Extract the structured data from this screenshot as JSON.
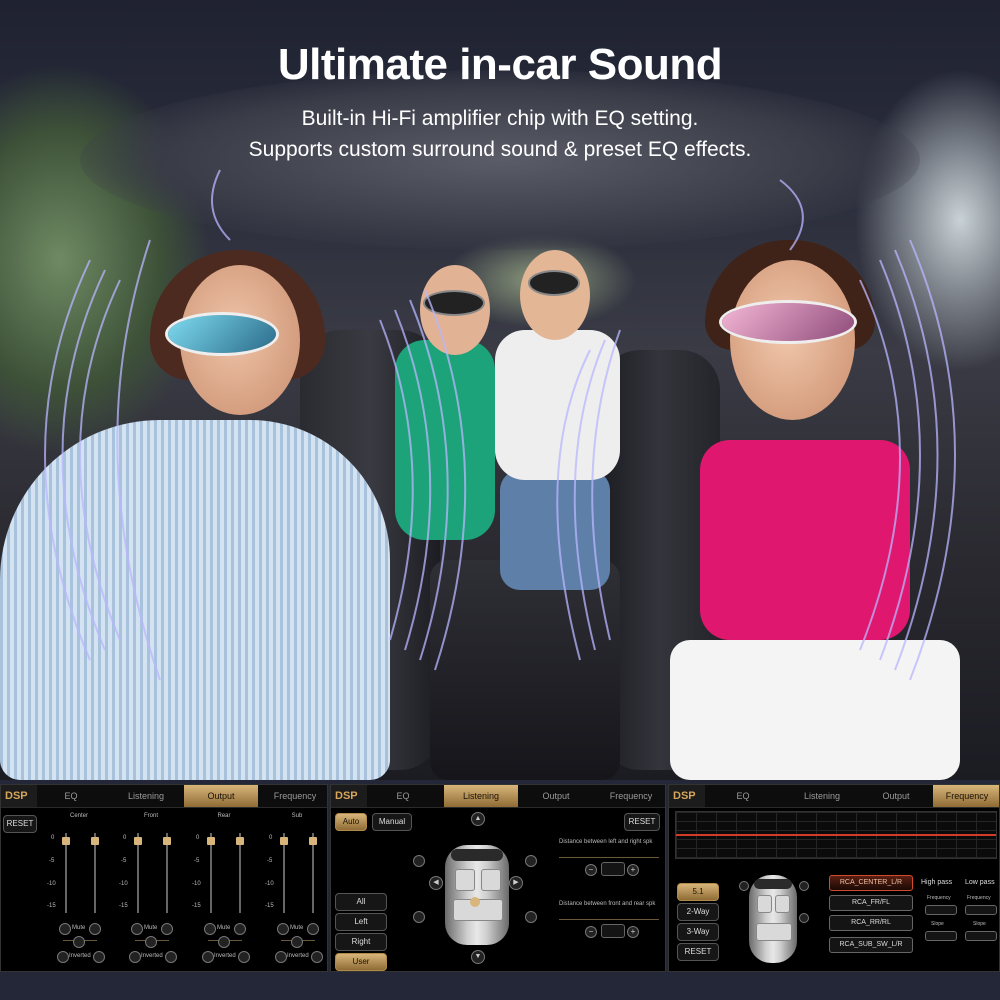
{
  "hero": {
    "title": "Ultimate in-car Sound",
    "line1": "Built-in Hi-Fi amplifier chip with EQ setting.",
    "line2": "Supports custom surround sound & preset EQ effects."
  },
  "colors": {
    "accent_gold": "#d8b57a",
    "eq_line": "#d23a2a",
    "panel_bg": "#000000",
    "wave": "#b9b6ff"
  },
  "panel1": {
    "tabs": [
      "DSP",
      "EQ",
      "Listening",
      "Output",
      "Frequency"
    ],
    "active_tab": "Output",
    "reset": "RESET",
    "channels": [
      {
        "name": "Center",
        "mute": "Mute",
        "inverted": "Inverted"
      },
      {
        "name": "Front",
        "mute": "Mute",
        "inverted": "Inverted"
      },
      {
        "name": "Rear",
        "mute": "Mute",
        "inverted": "Inverted"
      },
      {
        "name": "Sub",
        "mute": "Mute",
        "inverted": "Inverted"
      }
    ],
    "scale": [
      "0",
      "-5",
      "-10",
      "-15"
    ]
  },
  "panel2": {
    "tabs": [
      "DSP",
      "EQ",
      "Listening",
      "Output",
      "Frequency"
    ],
    "active_tab": "Listening",
    "auto": "Auto",
    "manual": "Manual",
    "reset": "RESET",
    "presets": [
      "All",
      "Left",
      "Right",
      "User"
    ],
    "distance_lr_label": "Distance between left and right spk",
    "distance_fr_label": "Distance between front and rear spk",
    "minus": "−",
    "plus": "+"
  },
  "panel3": {
    "tabs": [
      "DSP",
      "EQ",
      "Listening",
      "Output",
      "Frequency"
    ],
    "active_tab": "Frequency",
    "modes": [
      "5.1",
      "2-Way",
      "3-Way",
      "RESET"
    ],
    "channels": [
      "RCA_CENTER_L/R",
      "RCA_FR/FL",
      "RCA_RR/RL",
      "RCA_SUB_SW_L/R"
    ],
    "high_pass": "High pass",
    "low_pass": "Low pass",
    "frequency": "Frequency",
    "slope": "Slope"
  }
}
